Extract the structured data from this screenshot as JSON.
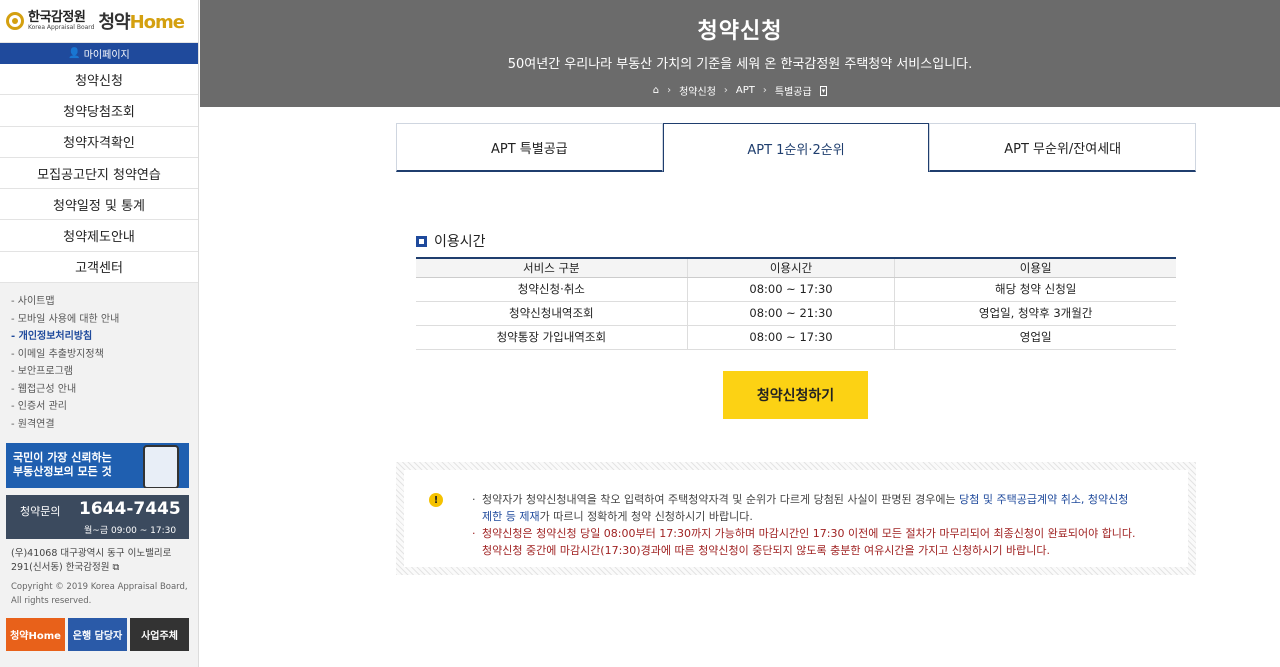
{
  "sidebar": {
    "logo_kr": "한국감정원",
    "logo_en": "Korea Appraisal Board",
    "logo_home_a": "청약",
    "logo_home_b": "Home",
    "mypage": "마이페이지",
    "menu": [
      "청약신청",
      "청약당첨조회",
      "청약자격확인",
      "모집공고단지 청약연습",
      "청약일정 및 통계",
      "청약제도안내",
      "고객센터"
    ],
    "links": [
      "- 사이트맵",
      "- 모바일 사용에 대한 안내",
      "- 개인정보처리방침",
      "- 이메일 추출방지정책",
      "- 보안프로그램",
      "- 웹접근성 안내",
      "- 인증서 관리",
      "- 원격연결"
    ],
    "banner1_line1": "국민이 가장 신뢰하는",
    "banner1_line2": "부동산정보의 모든 것",
    "banner2_label": "청약문의",
    "banner2_phone": "1644-7445",
    "banner2_hours": "월~금 09:00 ~ 17:30",
    "address_line1": "(우)41068 대구광역시 동구 이노밸리로",
    "address_line2": "291(신서동) 한국감정원",
    "copyright_line1": "Copyright © 2019 Korea Appraisal Board,",
    "copyright_line2": "All rights reserved.",
    "btn_home": "청약Home",
    "btn_bank": "은행 담당자",
    "btn_biz": "사업주체"
  },
  "header": {
    "title": "청약신청",
    "subtitle": "50여년간 우리나라 부동산 가치의 기준을 세워 온 한국감정원 주택청약 서비스입니다.",
    "crumbs": [
      "청약신청",
      "APT",
      "특별공급"
    ]
  },
  "tabs": [
    "APT 특별공급",
    "APT 1순위·2순위",
    "APT 무순위/잔여세대"
  ],
  "usage": {
    "title": "이용시간",
    "headers": [
      "서비스 구분",
      "이용시간",
      "이용일"
    ],
    "rows": [
      [
        "청약신청·취소",
        "08:00 ~ 17:30",
        "해당 청약 신청일"
      ],
      [
        "청약신청내역조회",
        "08:00 ~ 21:30",
        "영업일, 청약후 3개월간"
      ],
      [
        "청약통장 가입내역조회",
        "08:00 ~ 17:30",
        "영업일"
      ]
    ]
  },
  "apply_button": "청약신청하기",
  "notice": {
    "line1a": "청약자가 청약신청내역을 착오 입력하여 주택청약자격 및 순위가 다르게 당첨된 사실이 판명된 경우에는 ",
    "line1b": "당첨 및 주택공급계약 취소, 청약신청",
    "line2a": "제한 등 제재",
    "line2b": "가 따르니 정확하게 청약 신청하시기 바랍니다.",
    "line3": "청약신청은 청약신청 당일 08:00부터 17:30까지 가능하며 마감시간인 17:30 이전에 모든 절차가 마무리되어 최종신청이 완료되어야 합니다.",
    "line4": "청약신청 중간에 마감시간(17:30)경과에 따른 청약신청이 중단되지 않도록 충분한 여유시간을 가지고 신청하시기 바랍니다."
  }
}
